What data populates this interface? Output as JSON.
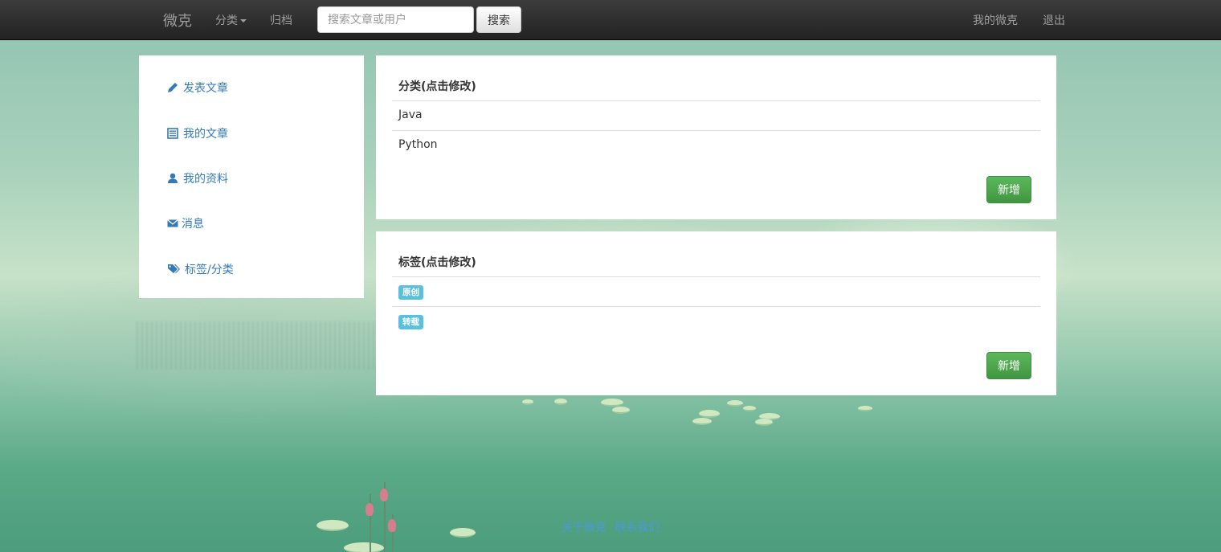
{
  "navbar": {
    "brand": "微克",
    "category_label": "分类",
    "archive_label": "归档",
    "search_placeholder": "搜索文章或用户",
    "search_button": "搜索",
    "my_weike": "我的微克",
    "logout": "退出"
  },
  "sidebar": {
    "items": [
      {
        "label": "发表文章",
        "icon": "pencil-icon"
      },
      {
        "label": "我的文章",
        "icon": "list-alt-icon"
      },
      {
        "label": "我的资料",
        "icon": "user-icon"
      },
      {
        "label": "消息",
        "icon": "envelope-icon"
      },
      {
        "label": "标签/分类",
        "icon": "tags-icon"
      }
    ]
  },
  "categories": {
    "title": "分类(点击修改)",
    "items": [
      "Java",
      "Python"
    ],
    "add_button": "新增"
  },
  "tags": {
    "title": "标签(点击修改)",
    "items": [
      "原创",
      "转载"
    ],
    "add_button": "新增"
  },
  "footer": {
    "links": [
      "关于微克",
      "联系我们"
    ]
  },
  "colors": {
    "navbar": "#222222",
    "link": "#337ab7",
    "success": "#5cb85c",
    "tag": "#5bc0de"
  }
}
